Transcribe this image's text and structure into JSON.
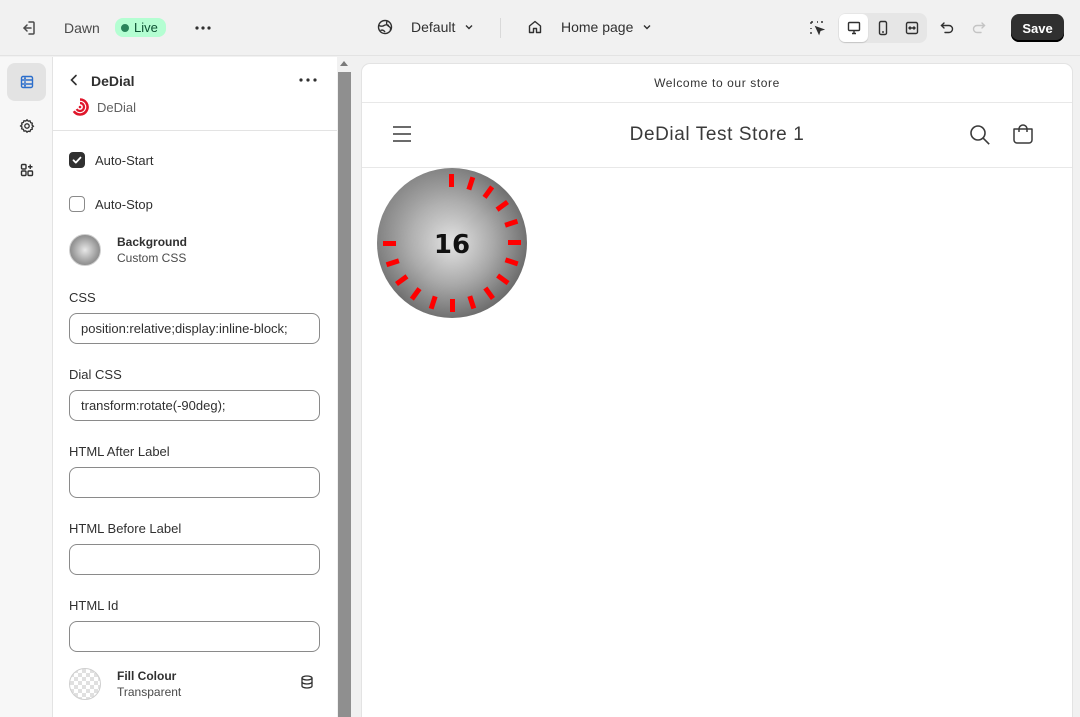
{
  "topbar": {
    "theme_name": "Dawn",
    "live_label": "Live",
    "preset_label": "Default",
    "page_label": "Home page",
    "save_label": "Save"
  },
  "panel": {
    "title": "DeDial",
    "subtitle": "DeDial",
    "auto_start": {
      "label": "Auto-Start",
      "checked": true
    },
    "auto_stop": {
      "label": "Auto-Stop",
      "checked": false
    },
    "background": {
      "title": "Background",
      "subtitle": "Custom CSS"
    },
    "fields": [
      {
        "label": "CSS",
        "value": "position:relative;display:inline-block;"
      },
      {
        "label": "Dial CSS",
        "value": "transform:rotate(-90deg);"
      },
      {
        "label": "HTML After Label",
        "value": ""
      },
      {
        "label": "HTML Before Label",
        "value": ""
      },
      {
        "label": "HTML Id",
        "value": ""
      }
    ],
    "fill_colour": {
      "title": "Fill Colour",
      "subtitle": "Transparent"
    }
  },
  "preview": {
    "announcement": "Welcome to our store",
    "store_name": "DeDial Test Store 1",
    "dial_value": "16",
    "dial_ticks_lit": 16,
    "dial_ticks_total": 20
  },
  "colors": {
    "accent_dark": "#303030",
    "live_bg": "#b4fed2",
    "live_dot": "#29845a",
    "dial_tick": "#ff0000",
    "rail_active": "#2c6ecb"
  }
}
